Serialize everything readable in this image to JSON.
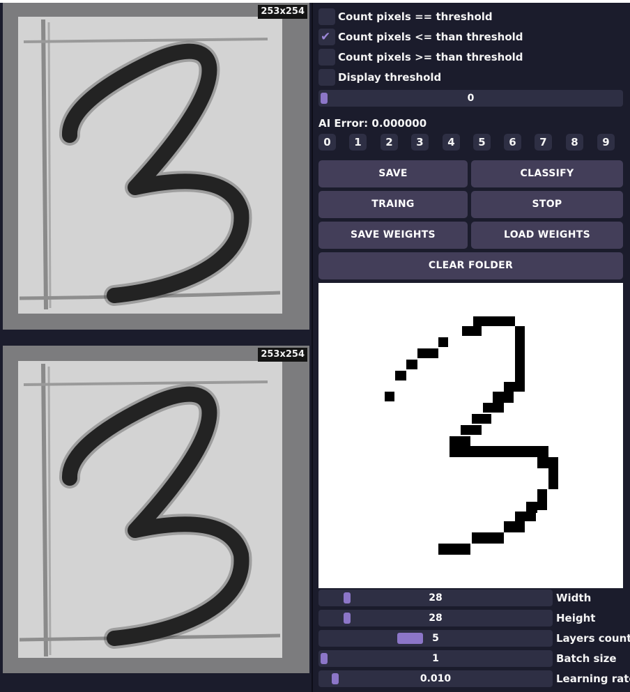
{
  "images": {
    "source": {
      "dimensions": "253x254"
    },
    "processed": {
      "dimensions": "253x254"
    }
  },
  "checkboxes": [
    {
      "label": "Count pixels ==  threshold",
      "checked": false
    },
    {
      "label": "Count pixels <= than threshold",
      "checked": true
    },
    {
      "label": "Count pixels >= than threshold",
      "checked": false
    },
    {
      "label": "Display threshold",
      "checked": false
    }
  ],
  "threshold": {
    "value": "0",
    "fraction": 0.0
  },
  "ai_error": "AI Error: 0.000000",
  "digits": [
    "0",
    "1",
    "2",
    "3",
    "4",
    "5",
    "6",
    "7",
    "8",
    "9"
  ],
  "buttons": {
    "save": "SAVE",
    "classify": "CLASSIFY",
    "training": "TRAING",
    "stop": "STOP",
    "save_weights": "SAVE WEIGHTS",
    "load_weights": "LOAD WEIGHTS",
    "clear_folder": "CLEAR FOLDER"
  },
  "sliders": [
    {
      "label": "Width",
      "value": "28",
      "fraction": 0.1
    },
    {
      "label": "Height",
      "value": "28",
      "fraction": 0.1
    },
    {
      "label": "Layers count",
      "value": "5",
      "fraction": 0.36
    },
    {
      "label": "Batch size",
      "value": "1",
      "fraction": 0.0
    },
    {
      "label": "Learning rate",
      "value": "0.010",
      "fraction": 0.05
    }
  ],
  "colors": {
    "accent": "#8c76c8",
    "button": "#433e59",
    "frame": "#2e2f44",
    "background": "#1b1c2c"
  }
}
